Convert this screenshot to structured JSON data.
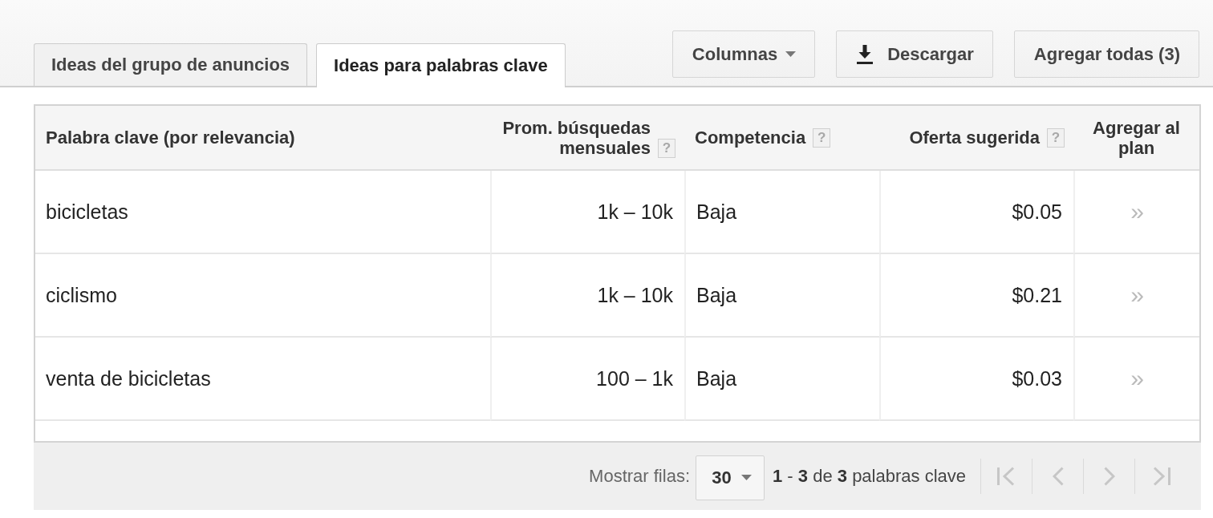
{
  "tabs": [
    {
      "label": "Ideas del grupo de anuncios",
      "selected": false
    },
    {
      "label": "Ideas para palabras clave",
      "selected": true
    }
  ],
  "toolbar": [
    {
      "kind": "dropdown",
      "label": "Columnas"
    },
    {
      "kind": "download",
      "label": "Descargar"
    },
    {
      "kind": "add",
      "label": "Agregar todas (3)"
    }
  ],
  "table": {
    "columns": [
      {
        "kind": "text",
        "label": "Palabra clave (por relevancia)"
      },
      {
        "kind": "number",
        "label": "Prom. búsquedas mensuales",
        "help": "?"
      },
      {
        "kind": "text",
        "label": "Competencia",
        "help": "?"
      },
      {
        "kind": "number",
        "label": "Oferta sugerida",
        "help": "?"
      },
      {
        "kind": "action",
        "label": "Agregar al plan"
      }
    ],
    "rows": [
      {
        "cells": [
          "bicicletas",
          "1k – 10k",
          "Baja",
          "$0.05"
        ],
        "add": "»"
      },
      {
        "cells": [
          "ciclismo",
          "1k – 10k",
          "Baja",
          "$0.21"
        ],
        "add": "»"
      },
      {
        "cells": [
          "venta de bicicletas",
          "100 – 1k",
          "Baja",
          "$0.03"
        ],
        "add": "»"
      }
    ]
  },
  "footer": {
    "rows_label": "Mostrar filas:",
    "rows_per_page": "30",
    "summary": "**1** - **3** de **3** palabras clave",
    "pager": [
      {
        "kind": "first",
        "disabled": true
      },
      {
        "kind": "previous",
        "disabled": true
      },
      {
        "kind": "next",
        "disabled": true
      },
      {
        "kind": "last",
        "disabled": true
      }
    ]
  }
}
